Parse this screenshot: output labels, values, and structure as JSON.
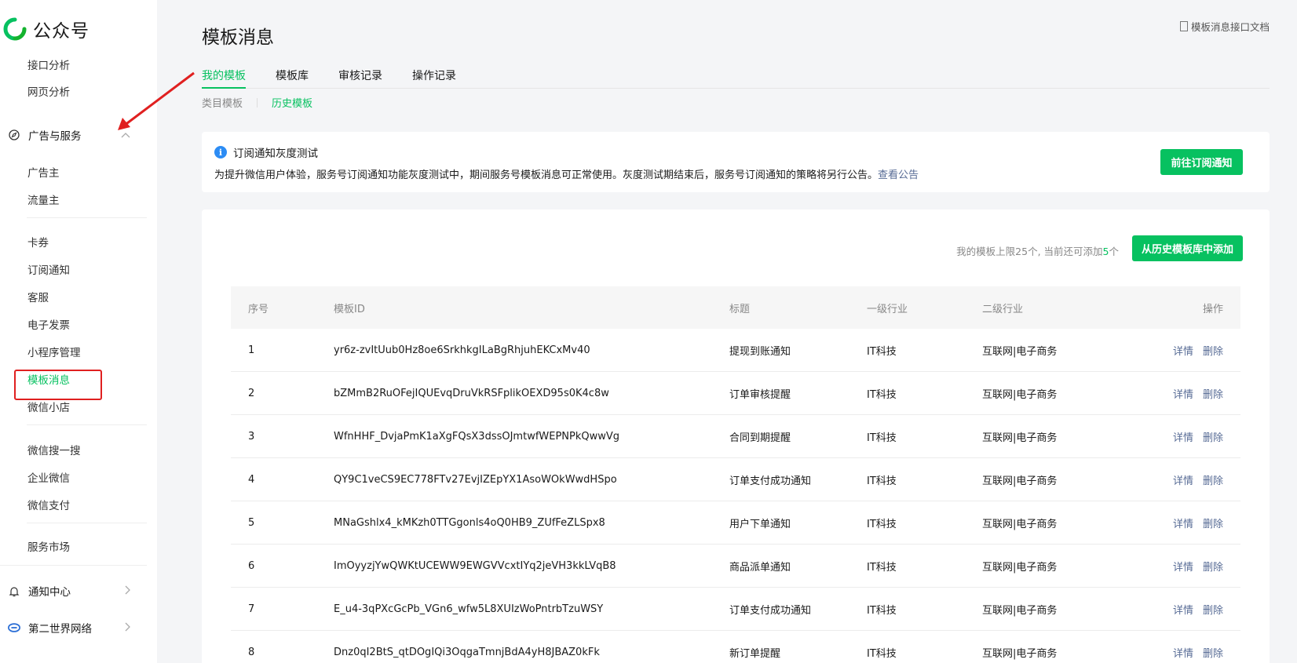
{
  "app": {
    "name": "公众号",
    "brand_color": "#07c160"
  },
  "sidebar": {
    "items_top": [
      {
        "label": "接口分析"
      },
      {
        "label": "网页分析"
      }
    ],
    "group_ads": {
      "label": "广告与服务",
      "icon": "compass-icon"
    },
    "items_ads": [
      {
        "label": "广告主"
      },
      {
        "label": "流量主"
      }
    ],
    "items_features": [
      {
        "label": "卡券"
      },
      {
        "label": "订阅通知"
      },
      {
        "label": "客服"
      },
      {
        "label": "电子发票"
      },
      {
        "label": "小程序管理"
      },
      {
        "label": "模板消息"
      },
      {
        "label": "微信小店"
      }
    ],
    "items_more": [
      {
        "label": "微信搜一搜"
      },
      {
        "label": "企业微信"
      },
      {
        "label": "微信支付"
      }
    ],
    "items_market": [
      {
        "label": "服务市场"
      }
    ],
    "notify": {
      "label": "通知中心"
    },
    "account": {
      "label": "第二世界网络"
    },
    "active_item": "模板消息"
  },
  "header": {
    "title": "模板消息",
    "doc_link": "模板消息接口文档"
  },
  "tabs": [
    {
      "label": "我的模板"
    },
    {
      "label": "模板库"
    },
    {
      "label": "审核记录"
    },
    {
      "label": "操作记录"
    }
  ],
  "subtabs": [
    {
      "label": "类目模板"
    },
    {
      "label": "历史模板"
    }
  ],
  "notice": {
    "title": "订阅通知灰度测试",
    "body": "为提升微信用户体验，服务号订阅通知功能灰度测试中，期间服务号模板消息可正常使用。灰度测试期结束后，服务号订阅通知的策略将另行公告。",
    "link": "查看公告",
    "button": "前往订阅通知"
  },
  "list": {
    "quota_prefix": "我的模板上限25个, 当前还可添加",
    "quota_remaining": "5",
    "quota_suffix": "个",
    "add_button": "从历史模板库中添加",
    "columns": [
      "序号",
      "模板ID",
      "标题",
      "一级行业",
      "二级行业",
      "操作"
    ],
    "detail_label": "详情",
    "delete_label": "删除",
    "rows": [
      {
        "idx": "1",
        "id": "yr6z-zvItUub0Hz8oe6SrkhkgILaBgRhjuhEKCxMv40",
        "title": "提现到账通知",
        "ind1": "IT科技",
        "ind2": "互联网|电子商务"
      },
      {
        "idx": "2",
        "id": "bZMmB2RuOFejIQUEvqDruVkRSFplikOEXD95s0K4c8w",
        "title": "订单审核提醒",
        "ind1": "IT科技",
        "ind2": "互联网|电子商务"
      },
      {
        "idx": "3",
        "id": "WfnHHF_DvjaPmK1aXgFQsX3dssOJmtwfWEPNPkQwwVg",
        "title": "合同到期提醒",
        "ind1": "IT科技",
        "ind2": "互联网|电子商务"
      },
      {
        "idx": "4",
        "id": "QY9C1veCS9EC778FTv27EvjIZEpYX1AsoWOkWwdHSpo",
        "title": "订单支付成功通知",
        "ind1": "IT科技",
        "ind2": "互联网|电子商务"
      },
      {
        "idx": "5",
        "id": "MNaGshlx4_kMKzh0TTGgonls4oQ0HB9_ZUfFeZLSpx8",
        "title": "用户下单通知",
        "ind1": "IT科技",
        "ind2": "互联网|电子商务"
      },
      {
        "idx": "6",
        "id": "ImOyyzjYwQWKtUCEWW9EWGVVcxtIYq2jeVH3kkLVqB8",
        "title": "商品派单通知",
        "ind1": "IT科技",
        "ind2": "互联网|电子商务"
      },
      {
        "idx": "7",
        "id": "E_u4-3qPXcGcPb_VGn6_wfw5L8XUIzWoPntrbTzuWSY",
        "title": "订单支付成功通知",
        "ind1": "IT科技",
        "ind2": "互联网|电子商务"
      },
      {
        "idx": "8",
        "id": "Dnz0qI2BtS_qtDOgIQi3OqgaTmnjBdA4yH8JBAZ0kFk",
        "title": "新订单提醒",
        "ind1": "IT科技",
        "ind2": "互联网|电子商务"
      }
    ]
  }
}
